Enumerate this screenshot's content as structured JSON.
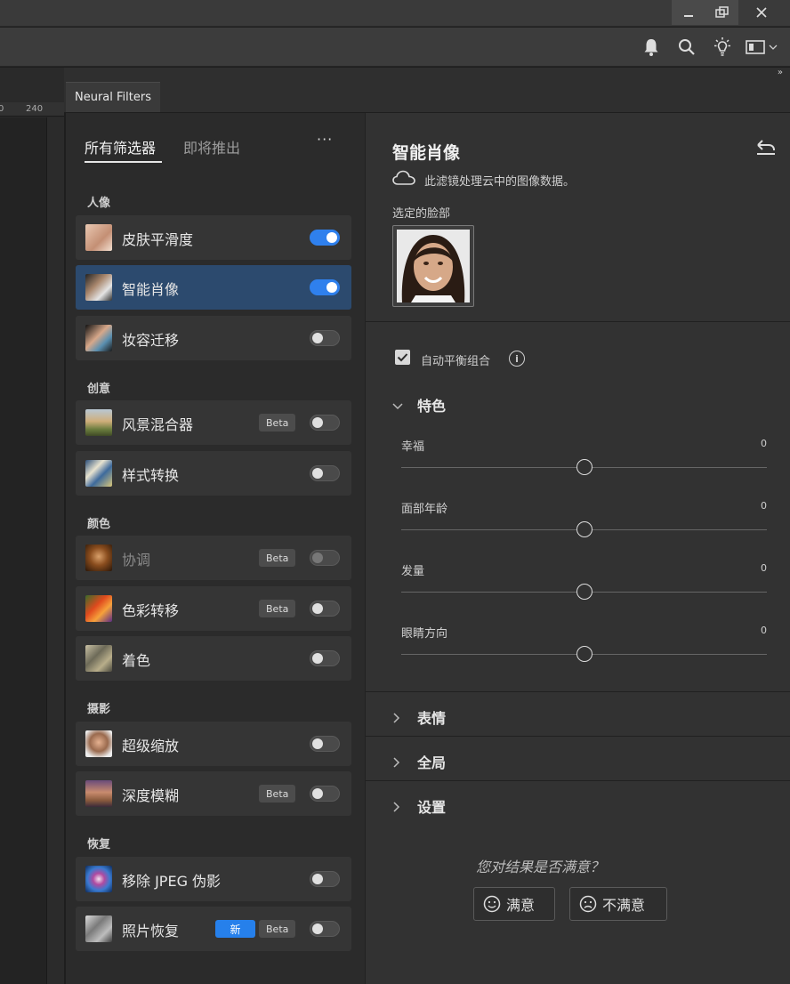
{
  "window": {
    "min_icon": "minimize-icon",
    "max_icon": "restore-icon",
    "close_icon": "close-icon"
  },
  "topbar": {
    "icons": [
      "bell-icon",
      "search-icon",
      "lightbulb-icon",
      "workspace-icon",
      "chevron-down-icon"
    ]
  },
  "ruler": {
    "tick_left": "0",
    "tick_240": "240"
  },
  "panel": {
    "tab": "Neural Filters",
    "collapse": "»"
  },
  "filters": {
    "tabs": {
      "all": "所有筛选器",
      "soon": "即将推出"
    },
    "more": "···",
    "categories": {
      "portrait": "人像",
      "creative": "创意",
      "color": "颜色",
      "photo": "摄影",
      "restore": "恢复"
    },
    "items": [
      {
        "name": "皮肤平滑度",
        "on": true
      },
      {
        "name": "智能肖像",
        "on": true,
        "selected": true
      },
      {
        "name": "妆容迁移",
        "on": false
      },
      {
        "name": "风景混合器",
        "badge": "Beta",
        "on": false
      },
      {
        "name": "样式转换",
        "on": false
      },
      {
        "name": "协调",
        "badge": "Beta",
        "on": false,
        "disabled": true
      },
      {
        "name": "色彩转移",
        "badge": "Beta",
        "on": false
      },
      {
        "name": "着色",
        "on": false
      },
      {
        "name": "超级缩放",
        "on": false
      },
      {
        "name": "深度模糊",
        "badge": "Beta",
        "on": false
      },
      {
        "name": "移除 JPEG 伪影",
        "on": false
      },
      {
        "name": "照片恢复",
        "badge": "Beta",
        "new_badge": "新",
        "on": false
      }
    ]
  },
  "details": {
    "title": "智能肖像",
    "cloud_text": "此滤镜处理云中的图像数据。",
    "face_label": "选定的脸部",
    "auto_balance": "自动平衡组合",
    "auto_balance_checked": true,
    "info": "i",
    "section_features": "特色",
    "sliders": [
      {
        "label": "幸福",
        "value": "0",
        "level": 0
      },
      {
        "label": "面部年龄",
        "value": "0",
        "level": 0
      },
      {
        "label": "发量",
        "value": "0",
        "level": 0
      },
      {
        "label": "眼睛方向",
        "value": "0",
        "level": 0
      }
    ],
    "section_expression": "表情",
    "section_global": "全局",
    "section_settings": "设置",
    "question": "您对结果是否满意？",
    "yes": "满意",
    "no": "不满意"
  },
  "colors": {
    "accent": "#2f80ed",
    "selected_row": "#2c4a6e",
    "new_badge": "#2680eb"
  }
}
